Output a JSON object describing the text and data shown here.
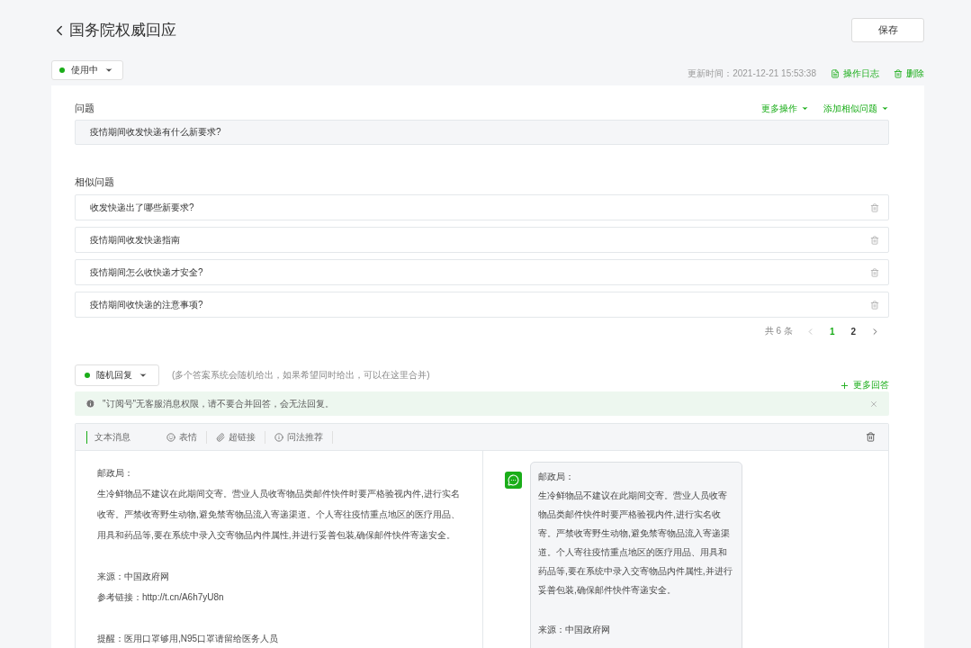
{
  "header": {
    "title": "国务院权威回应",
    "save_button": "保存"
  },
  "status_bar": {
    "status": {
      "label": "使用中",
      "color": "#1aad19"
    },
    "updated": "更新时间：2021-12-21 15:53:38",
    "log_link": "操作日志",
    "delete_link": "删除"
  },
  "question": {
    "label": "问题",
    "more_actions": "更多操作",
    "add_similar": "添加相似问题",
    "value": "疫情期间收发快递有什么新要求?"
  },
  "similar": {
    "label": "相似问题",
    "items": [
      {
        "text": "收发快递出了哪些新要求?"
      },
      {
        "text": "疫情期间收发快递指南"
      },
      {
        "text": "疫情期间怎么收快递才安全?"
      },
      {
        "text": "疫情期间收快递的注意事项?"
      }
    ],
    "pagination": {
      "total": "共 6 条",
      "pages": [
        {
          "label": "1",
          "selected": true
        },
        {
          "label": "2",
          "selected": false
        }
      ]
    }
  },
  "reply": {
    "mode": {
      "label": "随机回复",
      "color": "#1aad19"
    },
    "hint": "(多个答案系统会随机给出，如果希望同时给出，可以在这里合并)",
    "more_answers": "更多回答",
    "notice": "\"订阅号\"无客服消息权限，请不要合并回答，会无法回复。",
    "toolbar": {
      "tab": "文本消息",
      "tools": [
        "表情",
        "超链接",
        "问法推荐"
      ]
    },
    "editor": {
      "paragraphs": [
        [
          "邮政局：",
          "生冷鲜物品不建议在此期间交寄。营业人员收寄物品类邮件快件时要严格验视内件,进行实名收寄。严禁收寄野生动物,避免禁寄物品流入寄递渠道。个人寄往疫情重点地区的医疗用品、用具和药品等,要在系统中录入交寄物品内件属性,并进行妥善包装,确保邮件快件寄递安全。"
        ],
        [
          "来源：中国政府网",
          "参考链接：http://t.cn/A6h7yU8n"
        ],
        [
          "提醒：医用口罩够用,N95口罩请留给医务人员"
        ]
      ]
    },
    "preview": {
      "paragraphs": [
        [
          "邮政局：",
          "生冷鲜物品不建议在此期间交寄。营业人员收寄物品类邮件快件时要严格验视内件,进行实名收寄。严禁收寄野生动物,避免禁寄物品流入寄递渠道。个人寄往疫情重点地区的医疗用品、用具和药品等,要在系统中录入交寄物品内件属性,并进行妥善包装,确保邮件快件寄递安全。"
        ],
        [
          "来源：中国政府网"
        ]
      ]
    }
  }
}
